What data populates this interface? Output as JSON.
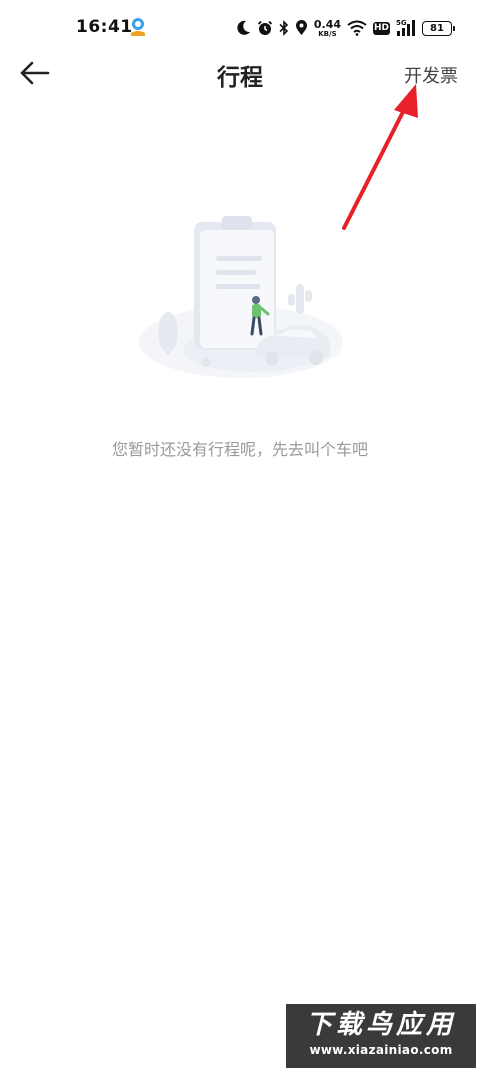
{
  "status_bar": {
    "time": "16:41",
    "net_speed_value": "0.44",
    "net_speed_unit": "KB/S",
    "hd_label": "HD",
    "network_label": "5G",
    "battery_level": "81",
    "icons": [
      "app-notification-icon",
      "moon-icon",
      "alarm-icon",
      "bluetooth-icon",
      "location-icon",
      "wifi-icon",
      "hd-icon",
      "cellular-signal-icon",
      "battery-icon"
    ]
  },
  "nav": {
    "title": "行程",
    "action_label": "开发票",
    "back_icon": "arrow-left-icon"
  },
  "empty_state": {
    "message": "您暂时还没有行程呢，先去叫个车吧"
  },
  "annotation": {
    "color": "#e8202a"
  },
  "watermark": {
    "brand": "下载鸟应用",
    "url": "www.xiazainiao.com"
  }
}
